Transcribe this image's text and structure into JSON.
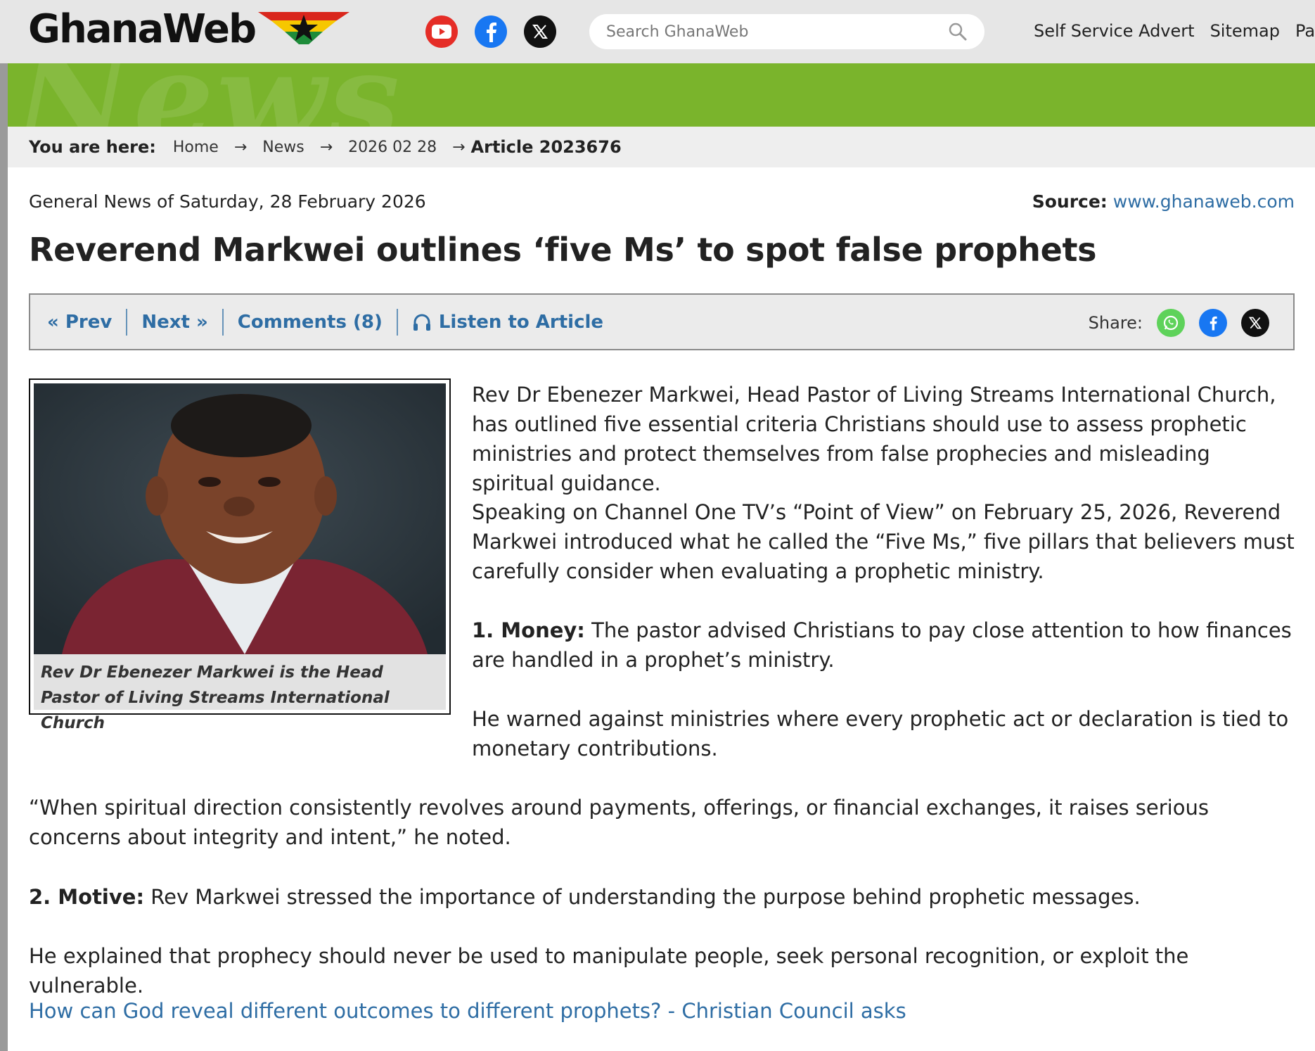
{
  "header": {
    "logo_text": "GhanaWeb",
    "search_placeholder": "Search GhanaWeb",
    "links": [
      "Self Service Advert",
      "Sitemap",
      "Partne"
    ]
  },
  "banner": {
    "watermark": "News"
  },
  "breadcrumb": {
    "label": "You are here:",
    "items": [
      "Home",
      "News",
      "2026 02 28"
    ],
    "arrow": "→",
    "current": "Article 2023676"
  },
  "article": {
    "meta": "General News of Saturday, 28 February 2026",
    "source_label": "Source:",
    "source_value": "www.ghanaweb.com",
    "headline": "Reverend Markwei outlines ‘five Ms’ to spot false prophets",
    "toolbar": {
      "prev": "« Prev",
      "next": "Next »",
      "comments": "Comments (8)",
      "listen": "Listen to Article",
      "share_label": "Share:"
    },
    "photo_caption": "Rev Dr Ebenezer Markwei is the Head Pastor of Living Streams International Church",
    "paragraphs": {
      "p1": "Rev Dr Ebenezer Markwei, Head Pastor of Living Streams International Church, has outlined five essential criteria Christians should use to assess prophetic ministries and protect themselves from false prophecies and misleading spiritual guidance.",
      "p2": "Speaking on Channel One TV’s “Point of View” on February 25, 2026, Reverend Markwei introduced what he called the “Five Ms,” five pillars that believers must carefully consider when evaluating a prophetic ministry.",
      "p3_bold": "1. Money:",
      "p3": " The pastor advised Christians to pay close attention to how finances are handled in a prophet’s ministry.",
      "p4": "He warned against ministries where every prophetic act or declaration is tied to monetary contributions.",
      "p5": "“When spiritual direction consistently revolves around payments, offerings, or financial exchanges, it raises serious concerns about integrity and intent,” he noted.",
      "p6_bold": "2. Motive:",
      "p6": " Rev Markwei stressed the importance of understanding the purpose behind prophetic messages.",
      "p7": "He explained that prophecy should never be used to manipulate people, seek personal recognition, or exploit the vulnerable."
    },
    "related_link": "How can God reveal different outcomes to different prophets? - Christian Council asks"
  },
  "colors": {
    "header_bg": "#e6e6e6",
    "banner_green": "#7ab42c",
    "link_blue": "#2e6da4",
    "youtube_red": "#e52d27",
    "facebook_blue": "#1877f2",
    "whatsapp_green": "#5ed25a"
  },
  "icons": [
    "youtube-icon",
    "facebook-icon",
    "x-icon",
    "search-icon",
    "headphones-icon",
    "whatsapp-icon"
  ]
}
